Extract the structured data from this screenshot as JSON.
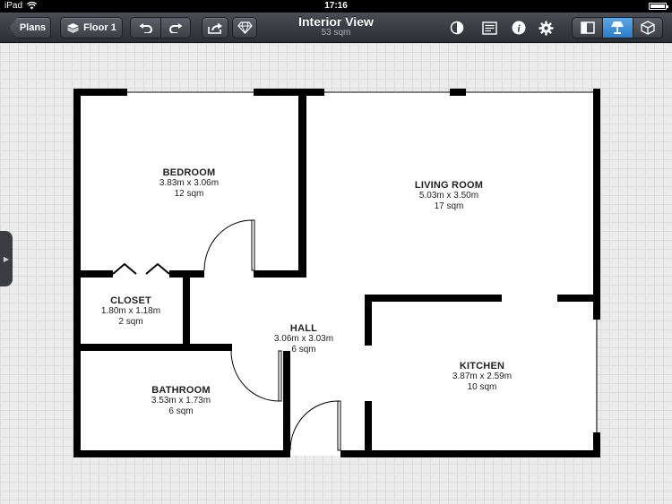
{
  "status_bar": {
    "device": "iPad",
    "time": "17:16"
  },
  "toolbar": {
    "back_label": "Plans",
    "floor_label": "Floor 1",
    "title": "Interior View",
    "subtitle": "53 sqm"
  },
  "rooms": {
    "bedroom": {
      "name": "BEDROOM",
      "dims": "3.83m x 3.06m",
      "area": "12 sqm"
    },
    "living": {
      "name": "LIVING ROOM",
      "dims": "5.03m x 3.50m",
      "area": "17 sqm"
    },
    "closet": {
      "name": "CLOSET",
      "dims": "1.80m x 1.18m",
      "area": "2 sqm"
    },
    "hall": {
      "name": "HALL",
      "dims": "3.06m x 3.03m",
      "area": "6 sqm"
    },
    "bathroom": {
      "name": "BATHROOM",
      "dims": "3.53m x 1.73m",
      "area": "6 sqm"
    },
    "kitchen": {
      "name": "KITCHEN",
      "dims": "3.87m x 2.59m",
      "area": "10 sqm"
    }
  },
  "icons": {
    "layers": "layers-icon",
    "undo": "undo-icon",
    "redo": "redo-icon",
    "share": "share-icon",
    "diamond": "diamond-icon",
    "contrast": "contrast-icon",
    "notes": "notes-icon",
    "info": "info-icon",
    "settings": "gear-icon",
    "layout": "layout-icon",
    "lamp": "lamp-icon",
    "box3d": "3d-box-icon"
  },
  "colors": {
    "wall": "#000000",
    "active_tool": "#3b8fd8"
  }
}
